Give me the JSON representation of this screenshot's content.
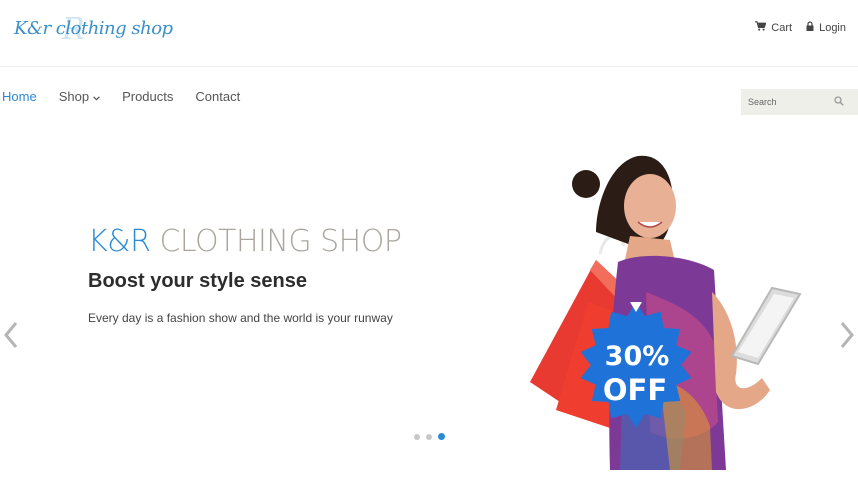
{
  "logo": {
    "text": "K&r clothing shop",
    "mark": "R"
  },
  "topbar": {
    "cart": {
      "label": "Cart",
      "icon": "cart-icon"
    },
    "login": {
      "label": "Login",
      "icon": "lock-icon"
    }
  },
  "nav": {
    "items": [
      {
        "label": "Home",
        "active": true
      },
      {
        "label": "Shop",
        "dropdown": true
      },
      {
        "label": "Products"
      },
      {
        "label": "Contact"
      }
    ]
  },
  "search": {
    "placeholder": "Search",
    "icon": "search-icon"
  },
  "hero": {
    "title_brand": "K&R",
    "title_rest": "CLOTHING SHOP",
    "subtitle": "Boost your style sense",
    "description": "Every day is a fashion show and the world is your runway",
    "badge_line1": "30%",
    "badge_line2": "OFF"
  },
  "slider": {
    "slide_count": 3,
    "active_slide": 3
  },
  "colors": {
    "accent": "#2b8ad6",
    "title_grey": "#aaa59f",
    "badge": "#1f73d8",
    "search_bg": "#efefea"
  }
}
